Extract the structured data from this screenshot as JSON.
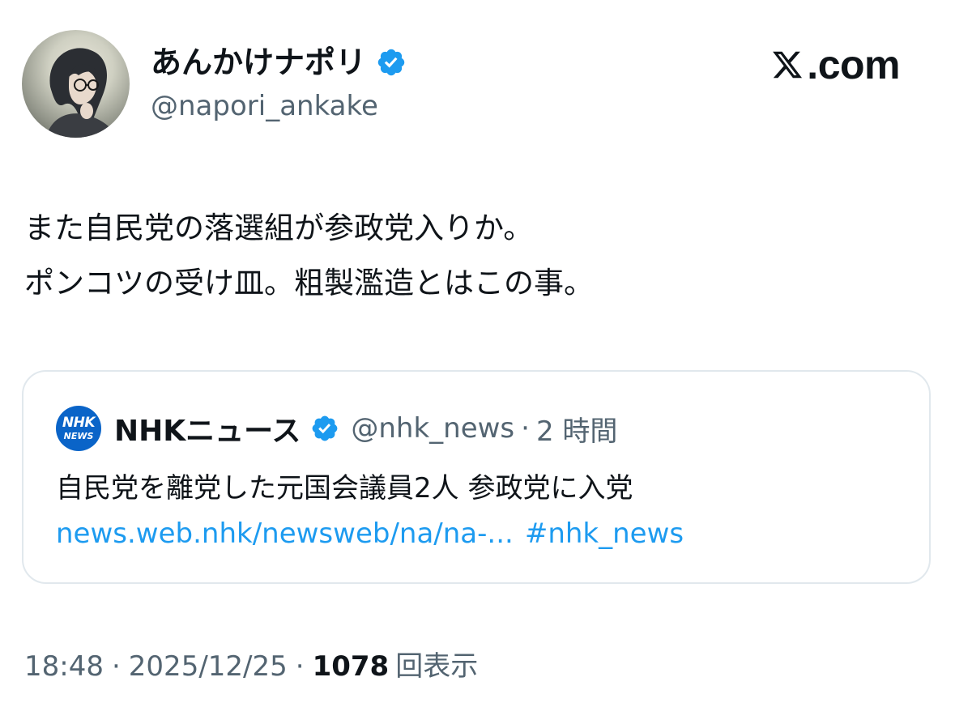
{
  "author": {
    "name": "あんかけナポリ",
    "handle": "@napori_ankake",
    "verified": true,
    "avatar_icon": "anime-avatar"
  },
  "brand": {
    "logo_icon": "x-logo-icon",
    "dotcom": ".com"
  },
  "tweet": {
    "lines": [
      "また自民党の落選組が参政党入りか。",
      "ポンコツの受け皿。粗製濫造とはこの事。"
    ]
  },
  "quote": {
    "logo_icon": "nhk-news-logo",
    "logo_line1": "NHK",
    "logo_line2": "NEWS",
    "name": "NHKニュース",
    "verified": true,
    "handle": "@nhk_news",
    "separator": "·",
    "time": "2 時間",
    "text": "自民党を離党した元国会議員2人 参政党に入党",
    "link": "news.web.nhk/newsweb/na/na-...",
    "hashtag": "#nhk_news"
  },
  "meta": {
    "time": "18:48",
    "sep1": "·",
    "date": "2025/12/25",
    "sep2": "·",
    "views_count": "1078",
    "views_label": "回表示"
  },
  "colors": {
    "text": "#0f1419",
    "secondary": "#536471",
    "link": "#1d9bf0",
    "verified": "#1d9bf0",
    "border": "#e1e8ed",
    "nhk_blue": "#0a64c8"
  }
}
